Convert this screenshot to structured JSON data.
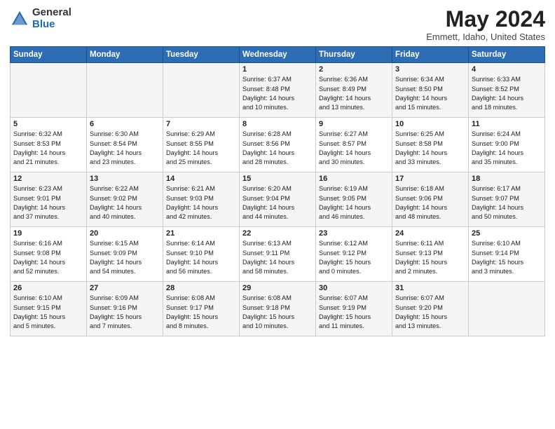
{
  "header": {
    "logo_general": "General",
    "logo_blue": "Blue",
    "month": "May 2024",
    "location": "Emmett, Idaho, United States"
  },
  "weekdays": [
    "Sunday",
    "Monday",
    "Tuesday",
    "Wednesday",
    "Thursday",
    "Friday",
    "Saturday"
  ],
  "weeks": [
    [
      {
        "day": "",
        "info": ""
      },
      {
        "day": "",
        "info": ""
      },
      {
        "day": "",
        "info": ""
      },
      {
        "day": "1",
        "info": "Sunrise: 6:37 AM\nSunset: 8:48 PM\nDaylight: 14 hours\nand 10 minutes."
      },
      {
        "day": "2",
        "info": "Sunrise: 6:36 AM\nSunset: 8:49 PM\nDaylight: 14 hours\nand 13 minutes."
      },
      {
        "day": "3",
        "info": "Sunrise: 6:34 AM\nSunset: 8:50 PM\nDaylight: 14 hours\nand 15 minutes."
      },
      {
        "day": "4",
        "info": "Sunrise: 6:33 AM\nSunset: 8:52 PM\nDaylight: 14 hours\nand 18 minutes."
      }
    ],
    [
      {
        "day": "5",
        "info": "Sunrise: 6:32 AM\nSunset: 8:53 PM\nDaylight: 14 hours\nand 21 minutes."
      },
      {
        "day": "6",
        "info": "Sunrise: 6:30 AM\nSunset: 8:54 PM\nDaylight: 14 hours\nand 23 minutes."
      },
      {
        "day": "7",
        "info": "Sunrise: 6:29 AM\nSunset: 8:55 PM\nDaylight: 14 hours\nand 25 minutes."
      },
      {
        "day": "8",
        "info": "Sunrise: 6:28 AM\nSunset: 8:56 PM\nDaylight: 14 hours\nand 28 minutes."
      },
      {
        "day": "9",
        "info": "Sunrise: 6:27 AM\nSunset: 8:57 PM\nDaylight: 14 hours\nand 30 minutes."
      },
      {
        "day": "10",
        "info": "Sunrise: 6:25 AM\nSunset: 8:58 PM\nDaylight: 14 hours\nand 33 minutes."
      },
      {
        "day": "11",
        "info": "Sunrise: 6:24 AM\nSunset: 9:00 PM\nDaylight: 14 hours\nand 35 minutes."
      }
    ],
    [
      {
        "day": "12",
        "info": "Sunrise: 6:23 AM\nSunset: 9:01 PM\nDaylight: 14 hours\nand 37 minutes."
      },
      {
        "day": "13",
        "info": "Sunrise: 6:22 AM\nSunset: 9:02 PM\nDaylight: 14 hours\nand 40 minutes."
      },
      {
        "day": "14",
        "info": "Sunrise: 6:21 AM\nSunset: 9:03 PM\nDaylight: 14 hours\nand 42 minutes."
      },
      {
        "day": "15",
        "info": "Sunrise: 6:20 AM\nSunset: 9:04 PM\nDaylight: 14 hours\nand 44 minutes."
      },
      {
        "day": "16",
        "info": "Sunrise: 6:19 AM\nSunset: 9:05 PM\nDaylight: 14 hours\nand 46 minutes."
      },
      {
        "day": "17",
        "info": "Sunrise: 6:18 AM\nSunset: 9:06 PM\nDaylight: 14 hours\nand 48 minutes."
      },
      {
        "day": "18",
        "info": "Sunrise: 6:17 AM\nSunset: 9:07 PM\nDaylight: 14 hours\nand 50 minutes."
      }
    ],
    [
      {
        "day": "19",
        "info": "Sunrise: 6:16 AM\nSunset: 9:08 PM\nDaylight: 14 hours\nand 52 minutes."
      },
      {
        "day": "20",
        "info": "Sunrise: 6:15 AM\nSunset: 9:09 PM\nDaylight: 14 hours\nand 54 minutes."
      },
      {
        "day": "21",
        "info": "Sunrise: 6:14 AM\nSunset: 9:10 PM\nDaylight: 14 hours\nand 56 minutes."
      },
      {
        "day": "22",
        "info": "Sunrise: 6:13 AM\nSunset: 9:11 PM\nDaylight: 14 hours\nand 58 minutes."
      },
      {
        "day": "23",
        "info": "Sunrise: 6:12 AM\nSunset: 9:12 PM\nDaylight: 15 hours\nand 0 minutes."
      },
      {
        "day": "24",
        "info": "Sunrise: 6:11 AM\nSunset: 9:13 PM\nDaylight: 15 hours\nand 2 minutes."
      },
      {
        "day": "25",
        "info": "Sunrise: 6:10 AM\nSunset: 9:14 PM\nDaylight: 15 hours\nand 3 minutes."
      }
    ],
    [
      {
        "day": "26",
        "info": "Sunrise: 6:10 AM\nSunset: 9:15 PM\nDaylight: 15 hours\nand 5 minutes."
      },
      {
        "day": "27",
        "info": "Sunrise: 6:09 AM\nSunset: 9:16 PM\nDaylight: 15 hours\nand 7 minutes."
      },
      {
        "day": "28",
        "info": "Sunrise: 6:08 AM\nSunset: 9:17 PM\nDaylight: 15 hours\nand 8 minutes."
      },
      {
        "day": "29",
        "info": "Sunrise: 6:08 AM\nSunset: 9:18 PM\nDaylight: 15 hours\nand 10 minutes."
      },
      {
        "day": "30",
        "info": "Sunrise: 6:07 AM\nSunset: 9:19 PM\nDaylight: 15 hours\nand 11 minutes."
      },
      {
        "day": "31",
        "info": "Sunrise: 6:07 AM\nSunset: 9:20 PM\nDaylight: 15 hours\nand 13 minutes."
      },
      {
        "day": "",
        "info": ""
      }
    ]
  ]
}
